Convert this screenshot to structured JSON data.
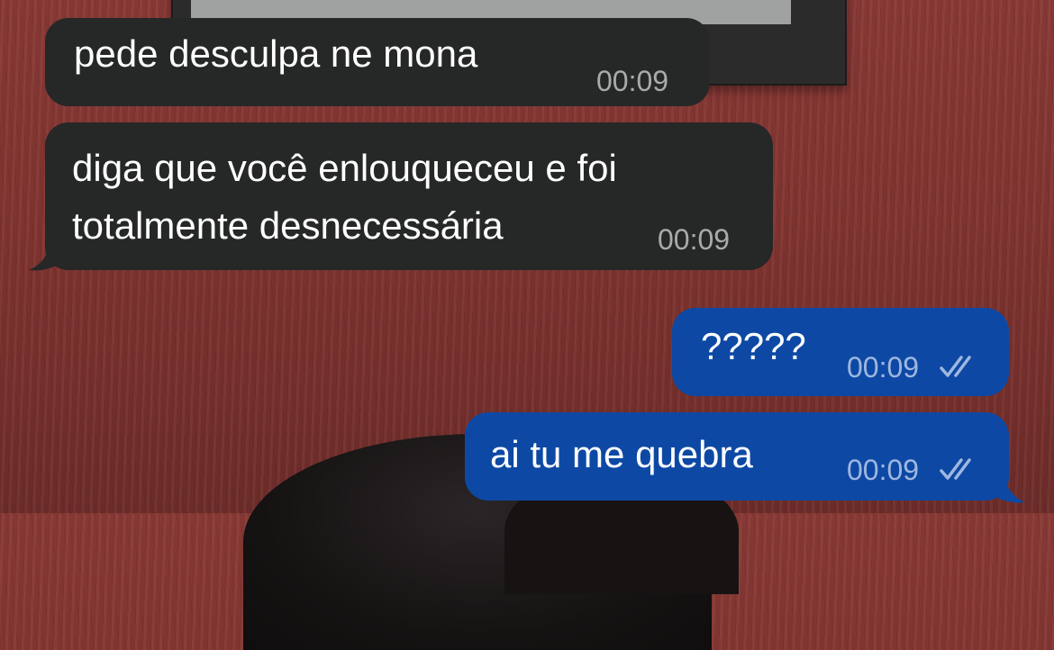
{
  "messages": [
    {
      "direction": "incoming",
      "text": "pede desculpa ne mona",
      "time": "00:09"
    },
    {
      "direction": "incoming",
      "lines": [
        "diga que você enlouqueceu e foi",
        "totalmente desnecessária"
      ],
      "time": "00:09"
    },
    {
      "direction": "outgoing",
      "text": "?????",
      "time": "00:09",
      "status": "read"
    },
    {
      "direction": "outgoing",
      "text": "ai tu me quebra",
      "time": "00:09",
      "status": "read"
    }
  ],
  "colors": {
    "incoming_bubble": "#262727",
    "outgoing_bubble": "#0d49a4",
    "wallpaper": "#823531"
  },
  "icons": {
    "read_status": "double-check-icon"
  }
}
